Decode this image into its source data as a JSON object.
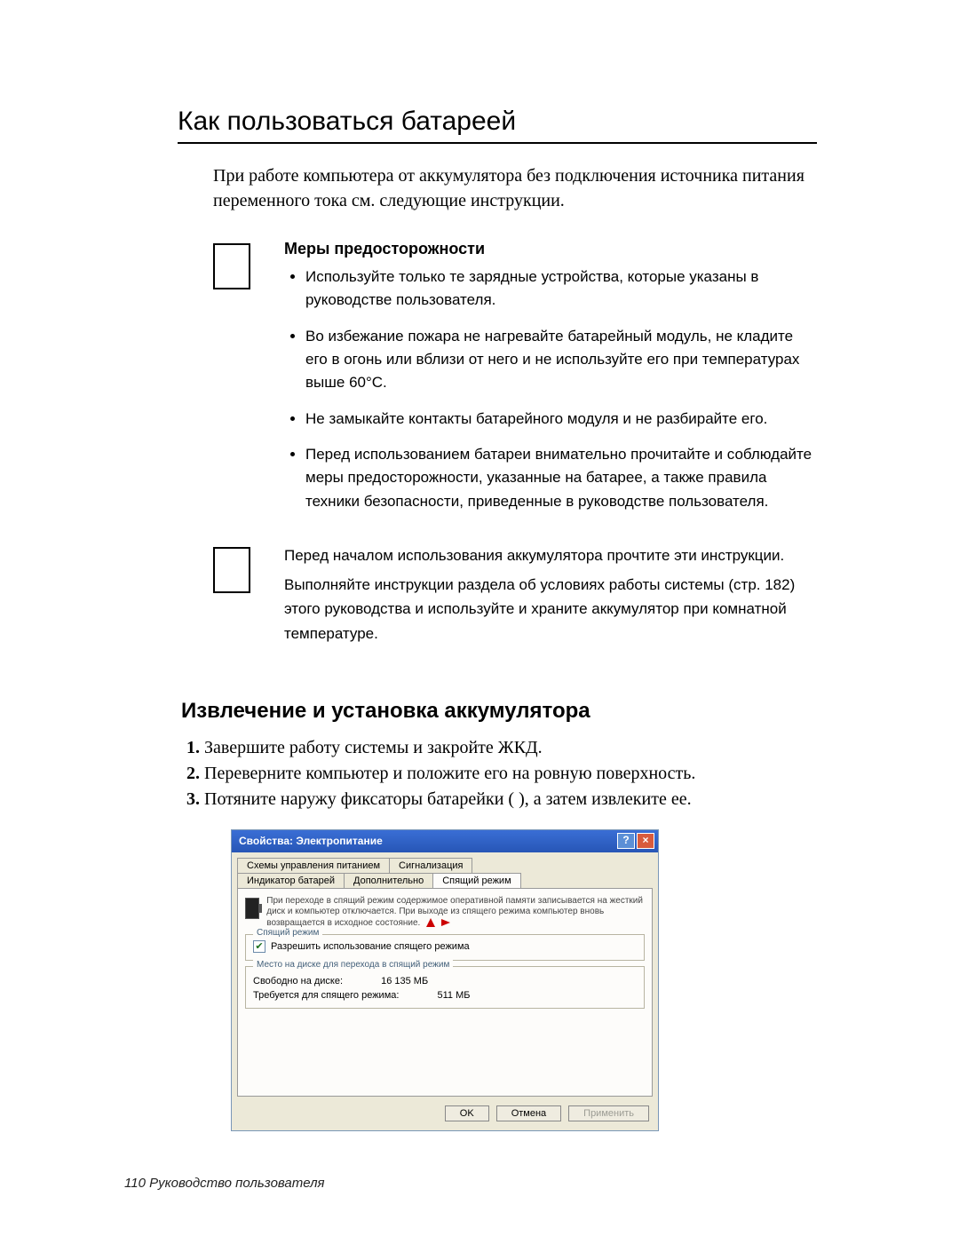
{
  "title": "Как пользоваться батареей",
  "intro": "При работе компьютера от аккумулятора без подключения источника питания переменного тока см. следующие инструкции.",
  "precautions": {
    "heading": "Меры предосторожности",
    "items": [
      "Используйте только те зарядные устройства, которые указаны в руководстве пользователя.",
      "Во избежание пожара не нагревайте батарейный модуль, не кладите его в огонь или вблизи от него и не используйте его при температурах выше 60°C.",
      "Не замыкайте контакты батарейного модуля и не разбирайте его.",
      "Перед использованием батареи внимательно прочитайте и соблюдайте меры предосторожности, указанные на батарее, а также правила техники безопасности, приведенные в руководстве пользователя."
    ]
  },
  "note": {
    "line1": "Перед началом использования аккумулятора прочтите эти инструкции.",
    "line2": "Выполняйте инструкции раздела об условиях работы системы (стр. 182) этого руководства и используйте и храните аккумулятор при комнатной температуре."
  },
  "subheading": "Извлечение и установка аккумулятора",
  "steps": [
    "Завершите работу системы и закройте ЖКД.",
    "Переверните компьютер и положите его на ровную поверхность.",
    "Потяните наружу фиксаторы батарейки (        ), а затем извлеките ее."
  ],
  "dialog": {
    "title": "Свойства: Электропитание",
    "tabs": {
      "t1": "Схемы управления питанием",
      "t2": "Сигнализация",
      "t3": "Индикатор батарей",
      "t4": "Дополнительно",
      "t5": "Спящий режим"
    },
    "info": "При переходе в спящий режим содержимое оперативной памяти записывается на жесткий диск и компьютер отключается. При выходе из спящего режима компьютер вновь возвращается в исходное состояние.",
    "group1_title": "Спящий режим",
    "checkbox_label": "Разрешить использование спящего режима",
    "group2_title": "Место на диске для перехода в спящий режим",
    "free_label": "Свободно на диске:",
    "free_value": "16 135 МБ",
    "req_label": "Требуется для спящего режима:",
    "req_value": "511 МБ",
    "ok": "OK",
    "cancel": "Отмена",
    "apply": "Применить"
  },
  "footer": "110  Руководство пользователя"
}
